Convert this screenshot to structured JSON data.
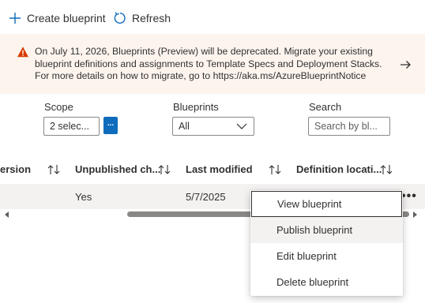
{
  "toolbar": {
    "create_label": "Create blueprint",
    "refresh_label": "Refresh"
  },
  "banner": {
    "message": "On July 11, 2026, Blueprints (Preview) will be deprecated. Migrate your existing blueprint definitions and assignments to Template Specs and Deployment Stacks. For more details on how to migrate, go to https://aka.ms/AzureBlueprintNotice"
  },
  "filters": {
    "scope_label": "Scope",
    "scope_value": "2 selec...",
    "scope_button": "...",
    "blueprints_label": "Blueprints",
    "blueprints_value": "All",
    "search_label": "Search",
    "search_placeholder": "Search by bl..."
  },
  "table": {
    "columns": [
      "ersion",
      "Unpublished ch...",
      "Last modified",
      "Definition locati..."
    ],
    "row": {
      "unpublished": "Yes",
      "last_modified": "5/7/2025",
      "more": "•••"
    }
  },
  "context_menu": {
    "items": [
      "View blueprint",
      "Publish blueprint",
      "Edit blueprint",
      "Delete blueprint"
    ]
  },
  "colors": {
    "accent": "#0f6cbd",
    "banner_bg": "#fdf4ee",
    "warning": "#d83b01",
    "row_bg": "#f3f2f1"
  }
}
